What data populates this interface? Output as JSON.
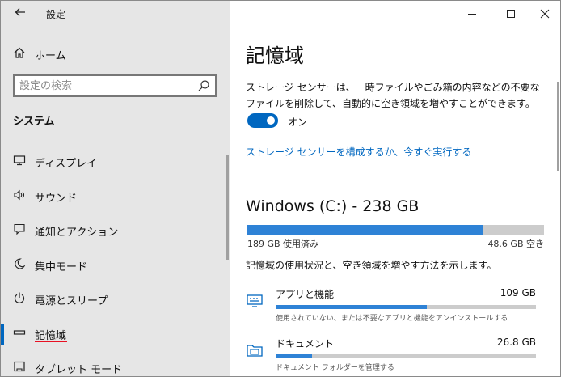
{
  "window": {
    "title": "設定"
  },
  "sidebar": {
    "home": "ホーム",
    "search_placeholder": "設定の検索",
    "section": "システム",
    "items": [
      {
        "label": "ディスプレイ",
        "icon": "monitor-icon"
      },
      {
        "label": "サウンド",
        "icon": "speaker-icon"
      },
      {
        "label": "通知とアクション",
        "icon": "notification-icon"
      },
      {
        "label": "集中モード",
        "icon": "moon-icon"
      },
      {
        "label": "電源とスリープ",
        "icon": "power-icon"
      },
      {
        "label": "記憶域",
        "icon": "storage-icon",
        "active": true
      },
      {
        "label": "タブレット モード",
        "icon": "tablet-icon"
      }
    ]
  },
  "main": {
    "title": "記憶域",
    "description": "ストレージ センサーは、一時ファイルやごみ箱の内容などの不要なファイルを削除して、自動的に空き領域を増やすことができます。",
    "toggle_label": "オン",
    "toggle_on": true,
    "link": "ストレージ センサーを構成するか、今すぐ実行する",
    "drive": {
      "title": "Windows (C:) - 238 GB",
      "used_label": "189 GB 使用済み",
      "free_label": "48.6 GB 空き",
      "used_fraction": 0.794
    },
    "usage_description": "記憶域の使用状況と、空き領域を増やす方法を示します。",
    "categories": [
      {
        "name": "アプリと機能",
        "size": "109 GB",
        "desc": "使用されていない、または不要なアプリと機能をアンインストールする",
        "fraction": 0.58,
        "icon": "apps-icon"
      },
      {
        "name": "ドキュメント",
        "size": "26.8 GB",
        "desc": "ドキュメント フォルダーを管理する",
        "fraction": 0.14,
        "icon": "folder-icon"
      }
    ]
  },
  "colors": {
    "accent": "#0067c0",
    "bar_fill": "#2e82d6",
    "bar_track": "#cccccc",
    "sidebar_bg": "#e6e6e6",
    "underline": "#e81123"
  }
}
